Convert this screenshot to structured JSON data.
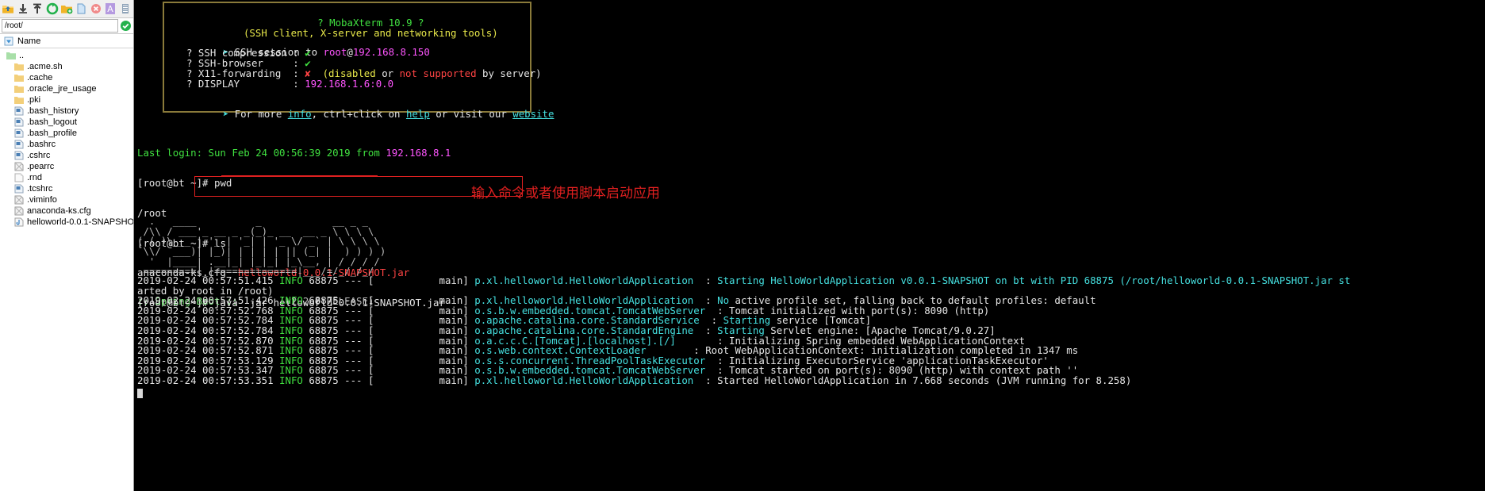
{
  "toolbar": {
    "buttons": [
      {
        "name": "up-folder-icon",
        "label": "Parent folder"
      },
      {
        "name": "download-icon",
        "label": "Download"
      },
      {
        "name": "upload-icon",
        "label": "Upload"
      },
      {
        "name": "refresh-icon",
        "label": "Refresh"
      },
      {
        "name": "new-folder-icon",
        "label": "New folder"
      },
      {
        "name": "new-file-icon",
        "label": "New file"
      },
      {
        "name": "delete-icon",
        "label": "Delete"
      },
      {
        "name": "text-mode-icon",
        "label": "Text mode"
      },
      {
        "name": "settings-icon",
        "label": "Settings"
      }
    ]
  },
  "pathbar": {
    "value": "/root/",
    "placeholder": "/root/",
    "ok_icon": "ok-check-icon"
  },
  "filelist": {
    "column_header": "Name",
    "items": [
      {
        "name": "..",
        "icon": "folder-up-icon"
      },
      {
        "name": ".acme.sh",
        "icon": "folder-icon"
      },
      {
        "name": ".cache",
        "icon": "folder-icon"
      },
      {
        "name": ".oracle_jre_usage",
        "icon": "folder-icon"
      },
      {
        "name": ".pki",
        "icon": "folder-icon"
      },
      {
        "name": ".bash_history",
        "icon": "file-text-icon"
      },
      {
        "name": ".bash_logout",
        "icon": "file-text-icon"
      },
      {
        "name": ".bash_profile",
        "icon": "file-text-icon"
      },
      {
        "name": ".bashrc",
        "icon": "file-text-icon"
      },
      {
        "name": ".cshrc",
        "icon": "file-text-icon"
      },
      {
        "name": ".pearrc",
        "icon": "file-unknown-icon"
      },
      {
        "name": ".rnd",
        "icon": "file-blank-icon"
      },
      {
        "name": ".tcshrc",
        "icon": "file-text-icon"
      },
      {
        "name": ".viminfo",
        "icon": "file-unknown-icon"
      },
      {
        "name": "anaconda-ks.cfg",
        "icon": "file-unknown-icon"
      },
      {
        "name": "helloworld-0.0.1-SNAPSHOT.jar",
        "icon": "file-jar-icon"
      }
    ]
  },
  "banner": {
    "title": "? MobaXterm 10.9 ?",
    "subtitle": "(SSH client, X-server and networking tools)",
    "session_prefix": "SSH session to ",
    "session_user": "root",
    "session_at": "@",
    "session_host": "192.168.8.150",
    "rows": [
      {
        "label": "? SSH compression :",
        "value": "✔",
        "state": "ok"
      },
      {
        "label": "? SSH-browser     :",
        "value": "✔",
        "state": "ok"
      },
      {
        "label": "? X11-forwarding  :",
        "value": "✘",
        "state": "bad",
        "note_open": "(",
        "note_yellow": "disabled",
        "note_mid": " or ",
        "note_red": "not supported",
        "note_close": " by server)"
      },
      {
        "label": "? DISPLAY         :",
        "value": "192.168.1.6:0.0",
        "state": "info"
      }
    ],
    "footer_prefix": "For more ",
    "footer_info": "info",
    "footer_mid": ", ctrl+click on ",
    "footer_help": "help",
    "footer_mid2": " or visit our ",
    "footer_website": "website"
  },
  "terminal": {
    "last_login_label": "Last login: Sun Feb 24 00:56:39 2019 from ",
    "last_login_host": "192.168.8.1",
    "prompt": "[root@bt ~]# ",
    "cmd_pwd": "pwd",
    "out_pwd": "/root",
    "cmd_ls": "ls",
    "ls_file1": "anaconda-ks.cfg",
    "ls_file2": "helloworld-0.0.1-SNAPSHOT.jar",
    "cmd_java": "java -jar helloworld-0.0.1-SNAPSHOT.jar",
    "spring_ascii": [
      "  .   ____          _            __ _ _",
      " /\\\\ / ___'_ __ _ _(_)_ __  __ _ \\ \\ \\ \\",
      "( ( )\\___ | '_ | '_| | '_ \\/ _` | \\ \\ \\ \\",
      " \\\\/  ___)| |_)| | | | | || (_| |  ) ) ) )",
      "  '  |____| .__|_| |_|_| |_\\__, | / / / /",
      " =========|_|==============|___/=/_/_/_/"
    ],
    "spring_label": ":: Spring Boot ::",
    "spring_version": "       (v2.2.0.RELEASE)",
    "log_lines": [
      {
        "ts": "2019-02-24 00:57:51.415",
        "level": "INFO",
        "pid": "68875",
        "sep": " --- [",
        "thread": "           main] ",
        "logger": "p.xl.helloworld.HelloWorldApplication",
        "colon": "  : ",
        "msg_parts": [
          {
            "t": "Starting HelloWorldApplication v0.0.1-SNAPSHOT on bt with PID 68875 (/root/helloworld-0.0.1-SNAPSHOT.jar st",
            "c": "cyn"
          }
        ]
      },
      {
        "cont": "arted by root in /root)"
      },
      {
        "ts": "2019-02-24 00:57:51.426",
        "level": "INFO",
        "pid": "68875",
        "sep": " --- [",
        "thread": "           main] ",
        "logger": "p.xl.helloworld.HelloWorldApplication",
        "colon": "  : ",
        "msg_parts": [
          {
            "t": "No",
            "c": "cyn"
          },
          {
            "t": " active profile set, falling back to default profiles: default",
            "c": "wht"
          }
        ]
      },
      {
        "ts": "2019-02-24 00:57:52.768",
        "level": "INFO",
        "pid": "68875",
        "sep": " --- [",
        "thread": "           main] ",
        "logger": "o.s.b.w.embedded.tomcat.TomcatWebServer",
        "colon": "  : ",
        "msg_parts": [
          {
            "t": "Tomcat initialized with port(s): 8090 (http)",
            "c": "wht"
          }
        ]
      },
      {
        "ts": "2019-02-24 00:57:52.784",
        "level": "INFO",
        "pid": "68875",
        "sep": " --- [",
        "thread": "           main] ",
        "logger": "o.apache.catalina.core.StandardService",
        "colon": "  : ",
        "msg_parts": [
          {
            "t": "Starting",
            "c": "cyn"
          },
          {
            "t": " service [Tomcat]",
            "c": "wht"
          }
        ]
      },
      {
        "ts": "2019-02-24 00:57:52.784",
        "level": "INFO",
        "pid": "68875",
        "sep": " --- [",
        "thread": "           main] ",
        "logger": "o.apache.catalina.core.StandardEngine",
        "colon": "  : ",
        "msg_parts": [
          {
            "t": "Starting",
            "c": "cyn"
          },
          {
            "t": " Servlet engine: [Apache Tomcat/9.0.27]",
            "c": "wht"
          }
        ]
      },
      {
        "ts": "2019-02-24 00:57:52.870",
        "level": "INFO",
        "pid": "68875",
        "sep": " --- [",
        "thread": "           main] ",
        "logger": "o.a.c.c.C.[Tomcat].[localhost].[/]",
        "colon": "       : ",
        "msg_parts": [
          {
            "t": "Initializing Spring embedded WebApplicationContext",
            "c": "wht"
          }
        ]
      },
      {
        "ts": "2019-02-24 00:57:52.871",
        "level": "INFO",
        "pid": "68875",
        "sep": " --- [",
        "thread": "           main] ",
        "logger": "o.s.web.context.ContextLoader",
        "colon": "        : ",
        "msg_parts": [
          {
            "t": "Root WebApplicationContext: initialization completed in 1347 ms",
            "c": "wht"
          }
        ]
      },
      {
        "ts": "2019-02-24 00:57:53.129",
        "level": "INFO",
        "pid": "68875",
        "sep": " --- [",
        "thread": "           main] ",
        "logger": "o.s.s.concurrent.ThreadPoolTaskExecutor",
        "colon": "  : ",
        "msg_parts": [
          {
            "t": "Initializing ExecutorService 'applicationTaskExecutor'",
            "c": "wht"
          }
        ]
      },
      {
        "ts": "2019-02-24 00:57:53.347",
        "level": "INFO",
        "pid": "68875",
        "sep": " --- [",
        "thread": "           main] ",
        "logger": "o.s.b.w.embedded.tomcat.TomcatWebServer",
        "colon": "  : ",
        "msg_parts": [
          {
            "t": "Tomcat started on port(s): 8090 (http) with context path ''",
            "c": "wht"
          }
        ]
      },
      {
        "ts": "2019-02-24 00:57:53.351",
        "level": "INFO",
        "pid": "68875",
        "sep": " --- [",
        "thread": "           main] ",
        "logger": "p.xl.helloworld.HelloWorldApplication",
        "colon": "  : ",
        "msg_parts": [
          {
            "t": "Started HelloWorldApplication in 7.668 seconds (JVM running for 8.258)",
            "c": "wht"
          }
        ]
      }
    ]
  },
  "annotations": {
    "command_note": "输入命令或者使用脚本启动应用",
    "accent_color": "#e02020"
  }
}
